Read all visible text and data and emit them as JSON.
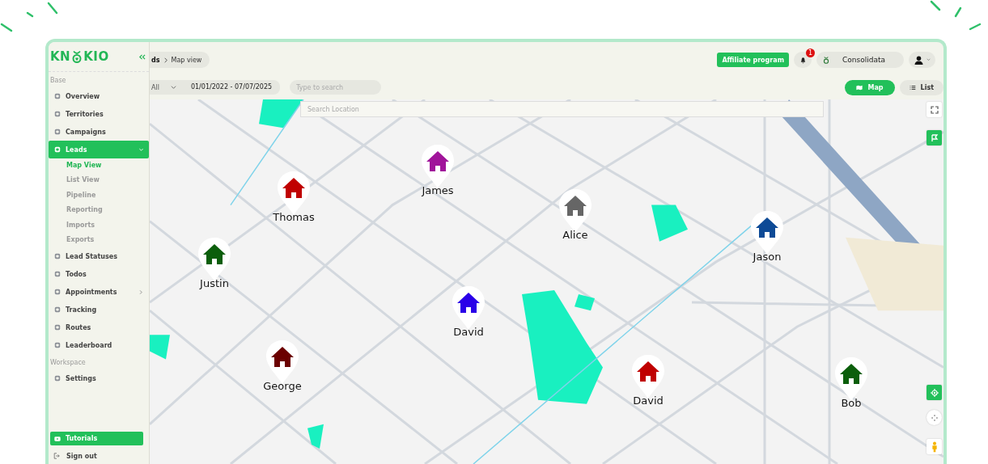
{
  "sidebar": {
    "logo": {
      "left": "KN",
      "right": "KIO"
    },
    "sections": [
      {
        "label": "Base",
        "items": [
          {
            "label": "Overview",
            "selected": false
          },
          {
            "label": "Territories",
            "selected": false
          },
          {
            "label": "Campaigns",
            "selected": false
          },
          {
            "label": "Leads",
            "selected": true,
            "expanded": true,
            "children": [
              {
                "label": "Map View",
                "selected": true
              },
              {
                "label": "List View",
                "selected": false
              },
              {
                "label": "Pipeline",
                "selected": false
              },
              {
                "label": "Reporting",
                "selected": false
              },
              {
                "label": "Imports",
                "selected": false
              },
              {
                "label": "Exports",
                "selected": false
              }
            ]
          },
          {
            "label": "Lead Statuses",
            "selected": false
          },
          {
            "label": "Todos",
            "selected": false
          },
          {
            "label": "Appointments",
            "selected": false,
            "expanded": false
          },
          {
            "label": "Tracking",
            "selected": false
          },
          {
            "label": "Routes",
            "selected": false
          },
          {
            "label": "Leaderboard",
            "selected": false
          }
        ]
      },
      {
        "label": "Workspace",
        "items": [
          {
            "label": "Settings",
            "selected": false
          }
        ]
      }
    ],
    "tutorials": "Tutorials",
    "sign_out": "Sign out"
  },
  "breadcrumb": [
    "ds",
    "Map view"
  ],
  "header": {
    "affiliate": "Affiliate program",
    "notifications": "1",
    "organization": "Consolidata"
  },
  "filters": {
    "status": "All",
    "date_range": "01/01/2022 - 07/07/2025",
    "search": {
      "placeholder": "Type to search"
    }
  },
  "view_toggle": [
    {
      "label": "Map",
      "selected": true
    },
    {
      "label": "List",
      "selected": false
    }
  ],
  "map": {
    "search": {
      "placeholder": "Search Location"
    },
    "pins": [
      {
        "name": "Thomas",
        "color": "#c00000"
      },
      {
        "name": "James",
        "color": "#a0149a"
      },
      {
        "name": "Alice",
        "color": "#666666"
      },
      {
        "name": "Jason",
        "color": "#0d4a96"
      },
      {
        "name": "Justin",
        "color": "#0b5e0b"
      },
      {
        "name": "David",
        "color": "#2a00e8"
      },
      {
        "name": "George",
        "color": "#6b0000"
      },
      {
        "name": "David",
        "color": "#c00000"
      },
      {
        "name": "Bob",
        "color": "#0b5e0b"
      }
    ]
  }
}
